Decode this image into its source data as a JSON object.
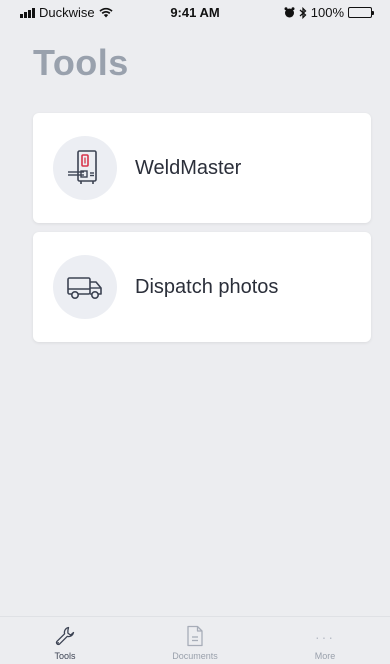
{
  "status_bar": {
    "carrier": "Duckwise",
    "time": "9:41 AM",
    "battery": "100%"
  },
  "page": {
    "title": "Tools"
  },
  "tools": [
    {
      "label": "WeldMaster",
      "icon": "weld-machine-icon"
    },
    {
      "label": "Dispatch photos",
      "icon": "truck-icon"
    }
  ],
  "tab_bar": {
    "tabs": [
      {
        "label": "Tools",
        "icon": "wrench-icon",
        "active": true
      },
      {
        "label": "Documents",
        "icon": "document-icon",
        "active": false
      },
      {
        "label": "More",
        "icon": "more-dots-icon",
        "active": false
      }
    ]
  },
  "colors": {
    "background": "#ecedf0",
    "title": "#99a1ad",
    "accent_red": "#d8344a",
    "icon_dark": "#3c4353"
  }
}
